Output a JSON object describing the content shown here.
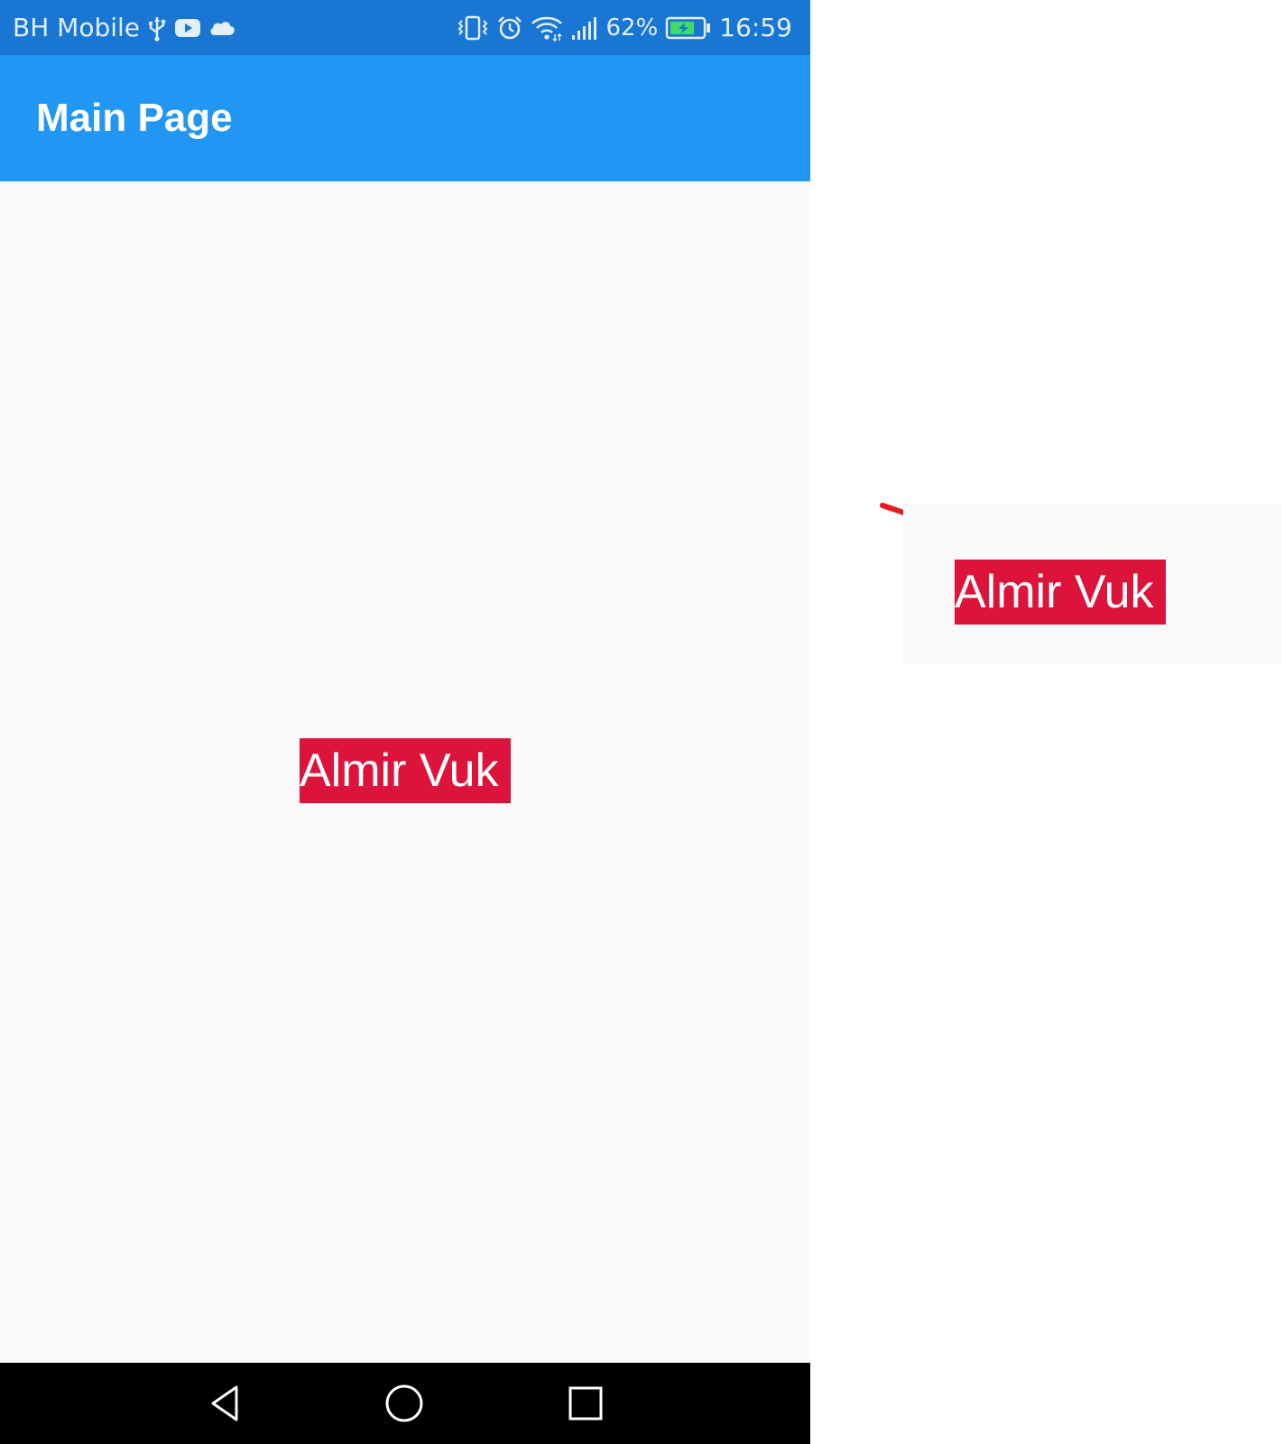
{
  "status_bar": {
    "carrier": "BH Mobile",
    "battery_percent": "62%",
    "time": "16:59",
    "icons_left": [
      "usb-icon",
      "youtube-icon",
      "cloud-icon"
    ],
    "icons_right": [
      "vibrate-icon",
      "alarm-icon",
      "wifi-icon",
      "signal-icon",
      "battery-charging-icon"
    ]
  },
  "app_bar": {
    "title": "Main Page"
  },
  "content": {
    "name_text": "Almir Vuk"
  },
  "zoom_callout": {
    "name_text": "Almir Vuk"
  },
  "nav_bar": {
    "buttons": [
      "back-icon",
      "home-icon",
      "recents-icon"
    ]
  },
  "colors": {
    "status_bar": "#1976d2",
    "app_bar": "#2196f3",
    "name_background": "#dc143c",
    "page_background": "#fafafa",
    "annotation_arrow": "#e31b23"
  }
}
